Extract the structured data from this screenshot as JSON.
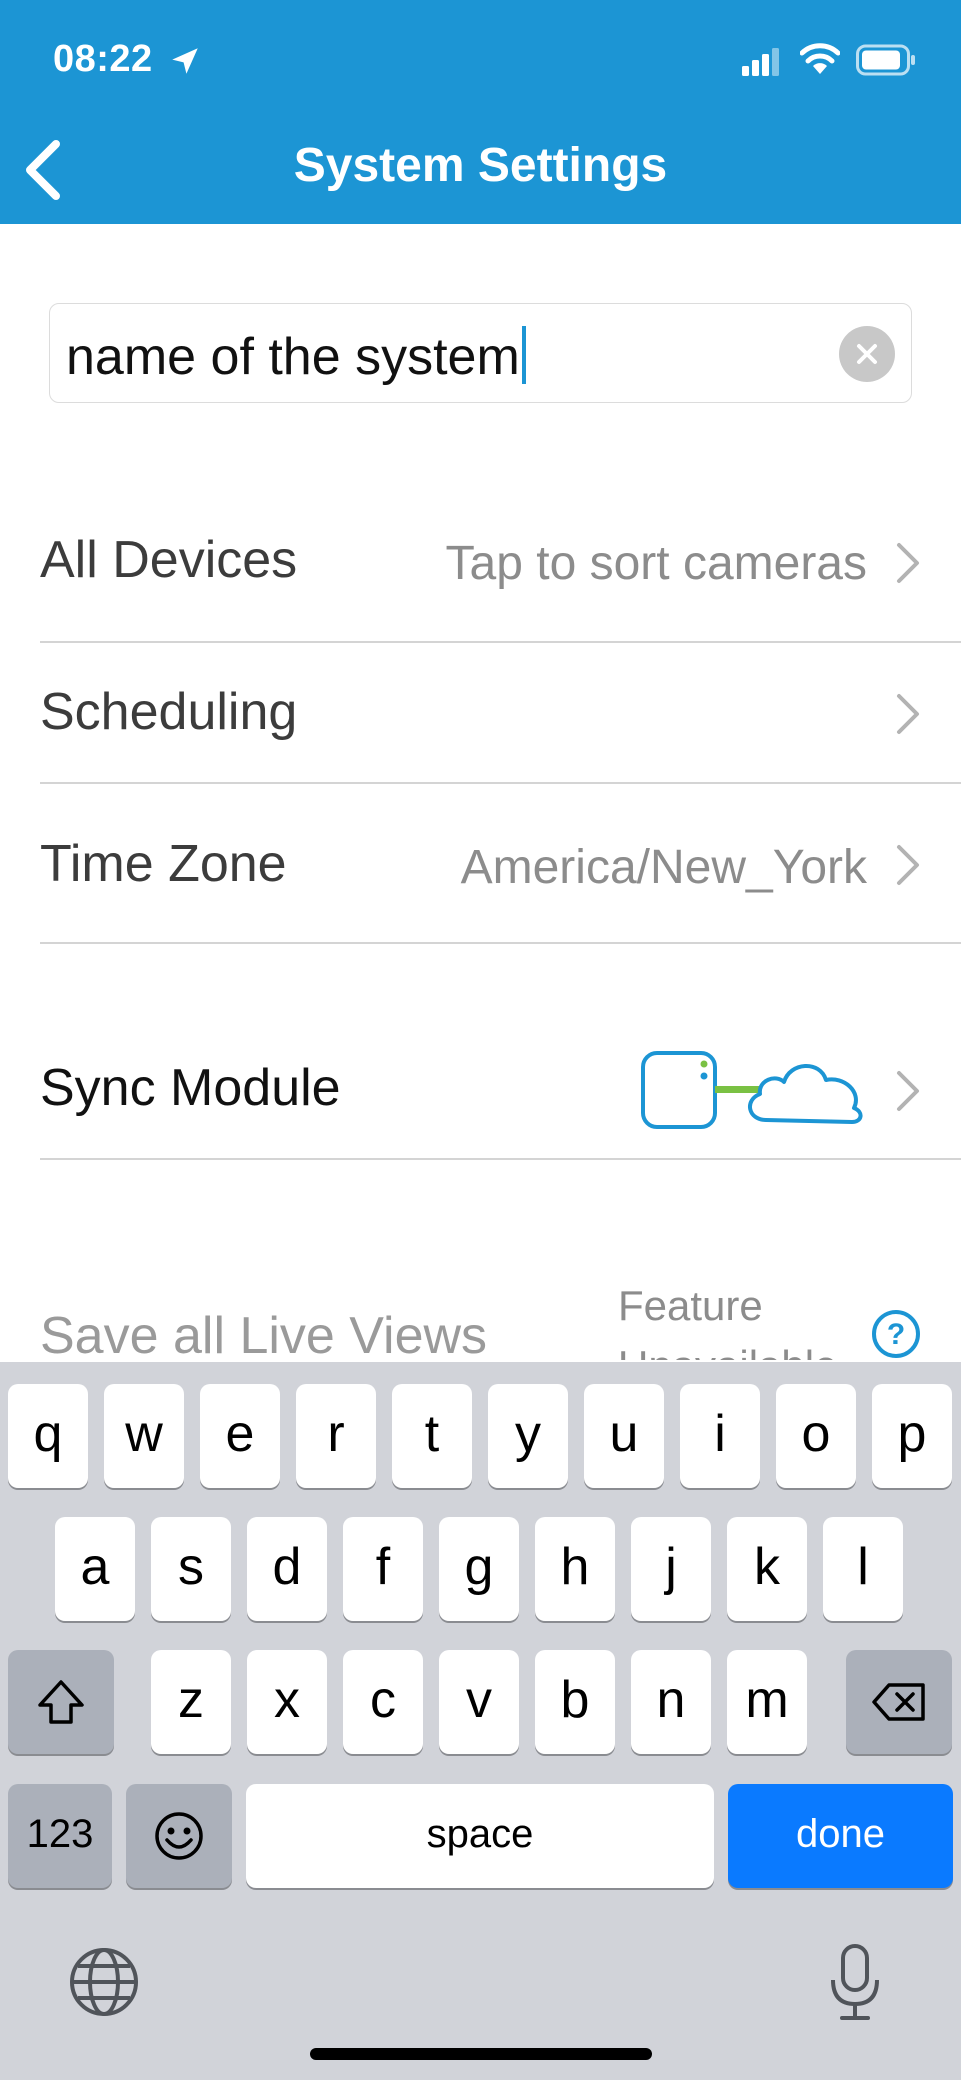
{
  "status_bar": {
    "time": "08:22"
  },
  "header": {
    "title": "System Settings",
    "back_icon": "chevron-left-icon"
  },
  "name_input": {
    "value": "name of the system",
    "clear_icon": "clear-circle-icon"
  },
  "rows": {
    "all_devices": {
      "label": "All Devices",
      "value": "Tap to sort cameras"
    },
    "scheduling": {
      "label": "Scheduling"
    },
    "time_zone": {
      "label": "Time Zone",
      "value": "America/New_York"
    },
    "sync_module": {
      "label": "Sync Module",
      "status_icon": "sync-module-cloud-connected-icon"
    },
    "live_views": {
      "label": "Save all Live Views",
      "value": "Feature Unavailable",
      "help_icon": "help-circle-icon"
    }
  },
  "keyboard": {
    "row1": [
      "q",
      "w",
      "e",
      "r",
      "t",
      "y",
      "u",
      "i",
      "o",
      "p"
    ],
    "row2": [
      "a",
      "s",
      "d",
      "f",
      "g",
      "h",
      "j",
      "k",
      "l"
    ],
    "row3": [
      "z",
      "x",
      "c",
      "v",
      "b",
      "n",
      "m"
    ],
    "numbers_label": "123",
    "space_label": "space",
    "done_label": "done"
  },
  "colors": {
    "accent": "#1c95d4",
    "done_key": "#0a7aff",
    "sync_link": "#7ac143"
  }
}
